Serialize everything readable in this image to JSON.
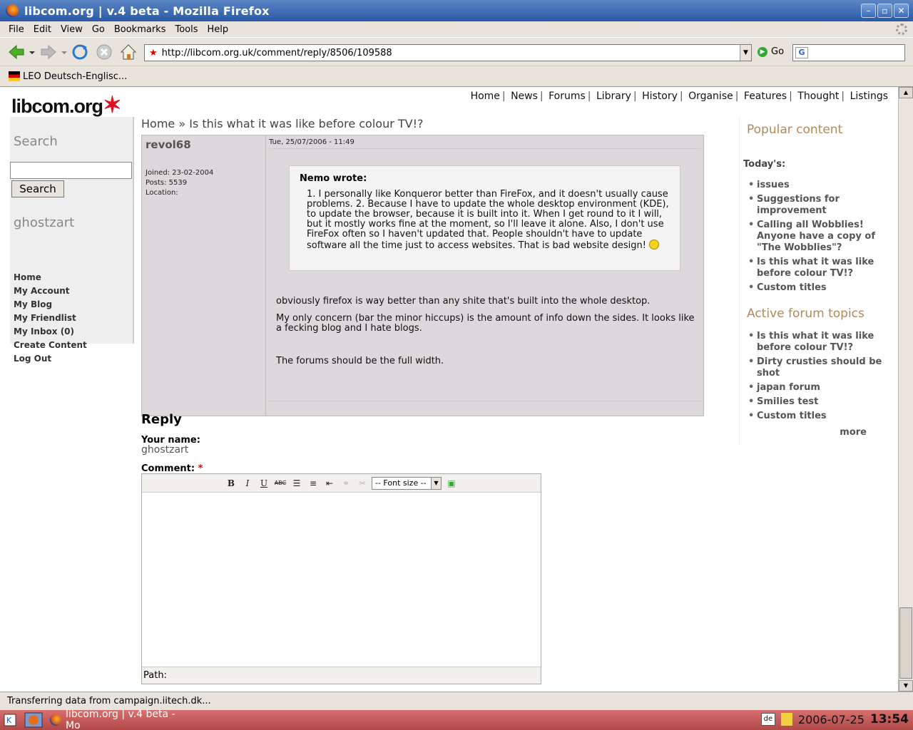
{
  "window": {
    "title": "libcom.org | v.4 beta - Mozilla Firefox"
  },
  "menubar": {
    "items": [
      "File",
      "Edit",
      "View",
      "Go",
      "Bookmarks",
      "Tools",
      "Help"
    ]
  },
  "navbar": {
    "url": "http://libcom.org.uk/comment/reply/8506/109588",
    "go_label": "Go"
  },
  "bookmarks": {
    "item": "LEO Deutsch-Englisc..."
  },
  "site": {
    "logo": "libcom.org",
    "topnav": [
      "Home",
      "News",
      "Forums",
      "Library",
      "History",
      "Organise",
      "Features",
      "Thought",
      "Listings"
    ]
  },
  "leftbar": {
    "search_title": "Search",
    "search_button": "Search",
    "user_title": "ghostzart",
    "links": [
      "Home",
      "My Account",
      "My Blog",
      "My Friendlist",
      "My Inbox (0)",
      "Create Content",
      "Log Out"
    ]
  },
  "breadcrumb": {
    "home": "Home",
    "sep": "»",
    "current": "Is this what it was like before colour TV!?"
  },
  "comment": {
    "author": "revol68",
    "joined": "Joined: 23-02-2004",
    "posts": "Posts: 5539",
    "location": "Location:",
    "date": "Tue, 25/07/2006 - 11:49",
    "quote_header": "Nemo wrote:",
    "quote_text": "1. I personally like Konqueror better than FireFox, and it doesn't usually cause problems. 2. Because I have to update the whole desktop environment (KDE), to update the browser, because it is built into it. When I get round to it I will, but it mostly works fine at the moment, so I'll leave it alone. Also, I don't use FireFox often so I haven't updated that. People shouldn't have to update software all the time just to access websites. That is bad website design!",
    "body": [
      "obviously firefox is way better than any shite that's built into the whole desktop.",
      "My only concern (bar the minor hiccups) is the amount of info down the sides. It looks like a fecking blog and I hate blogs.",
      "The forums should be the full width."
    ]
  },
  "reply": {
    "heading": "Reply",
    "name_label": "Your name:",
    "name_value": "ghostzart",
    "comment_label": "Comment:",
    "required_mark": "*",
    "font_size_placeholder": "-- Font size --",
    "path_label": "Path:"
  },
  "rightbar": {
    "popular_title": "Popular content",
    "todays_label": "Today's:",
    "popular_items": [
      "issues",
      "Suggestions for improvement",
      "Calling all Wobblies! Anyone have a copy of \"The Wobblies\"?",
      "Is this what it was like before colour TV!?",
      "Custom titles"
    ],
    "active_title": "Active forum topics",
    "active_items": [
      "Is this what it was like before colour TV!?",
      "Dirty crusties should be shot",
      "japan forum",
      "Smilies test",
      "Custom titles"
    ],
    "more": "more"
  },
  "statusbar": {
    "text": "Transferring data from campaign.iitech.dk..."
  },
  "taskbar": {
    "task": "libcom.org | v.4 beta - Mo",
    "lang": "de",
    "date": "2006-07-25",
    "time": "13:54"
  }
}
